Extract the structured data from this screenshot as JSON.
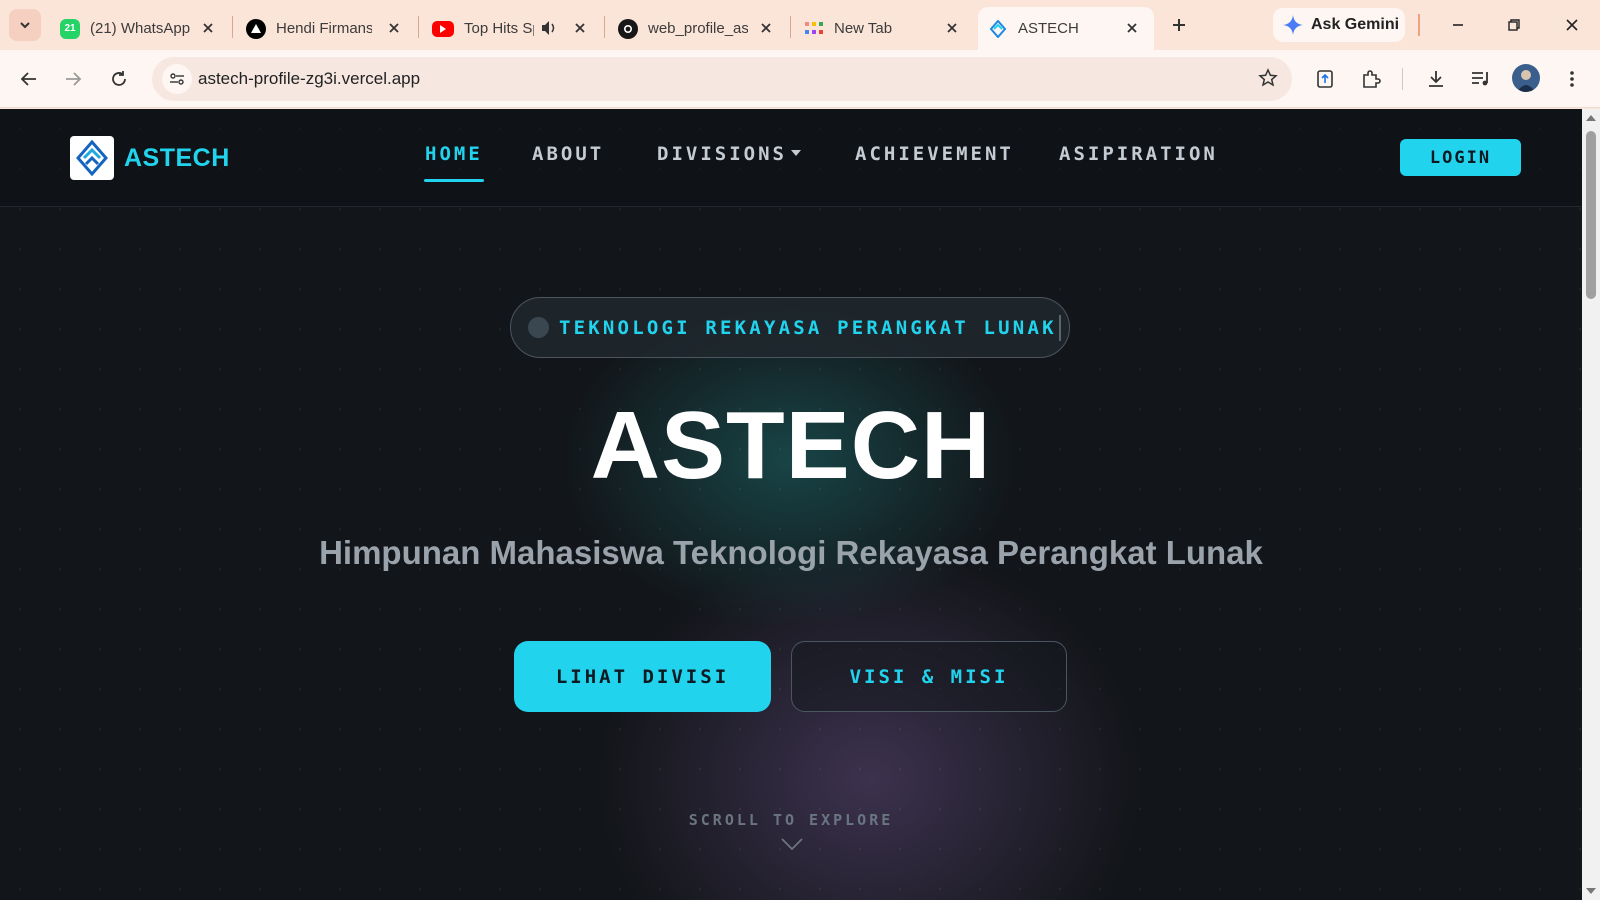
{
  "browser": {
    "tabs": [
      {
        "title": "(21) WhatsApp",
        "favicon": "whatsapp-icon",
        "badge": "21",
        "color": "#25d366"
      },
      {
        "title": "Hendi Firmansyah",
        "favicon": "vercel-icon",
        "color": "#000000"
      },
      {
        "title": "Top Hits Spotify",
        "favicon": "youtube-icon",
        "color": "#ff0000"
      },
      {
        "title": "web_profile_astech",
        "favicon": "github-icon",
        "color": "#181717"
      },
      {
        "title": "New Tab",
        "favicon": "new-tab-icon",
        "color": "#e0e0e0"
      },
      {
        "title": "ASTECH",
        "favicon": "astech-icon",
        "color": "#1e88e5",
        "active": true
      }
    ],
    "gemini_label": "Ask Gemini",
    "url": "astech-profile-zg3i.vercel.app",
    "accent_color": "#fbe4d8"
  },
  "site": {
    "brand": "ASTECH",
    "nav": {
      "home": "HOME",
      "about": "ABOUT",
      "divisions": "DIVISIONS",
      "achievement": "ACHIEVEMENT",
      "aspiration": "ASIPIRATION"
    },
    "login": "LOGIN",
    "accent_color": "#22d3ee"
  },
  "hero": {
    "badge": "TEKNOLOGI REKAYASA PERANGKAT LUNAK",
    "title": "ASTECH",
    "subtitle": "Himpunan Mahasiswa Teknologi Rekayasa Perangkat Lunak",
    "primary_button": "LIHAT DIVISI",
    "secondary_button": "VISI & MISI",
    "scroll_hint": "SCROLL TO EXPLORE"
  }
}
